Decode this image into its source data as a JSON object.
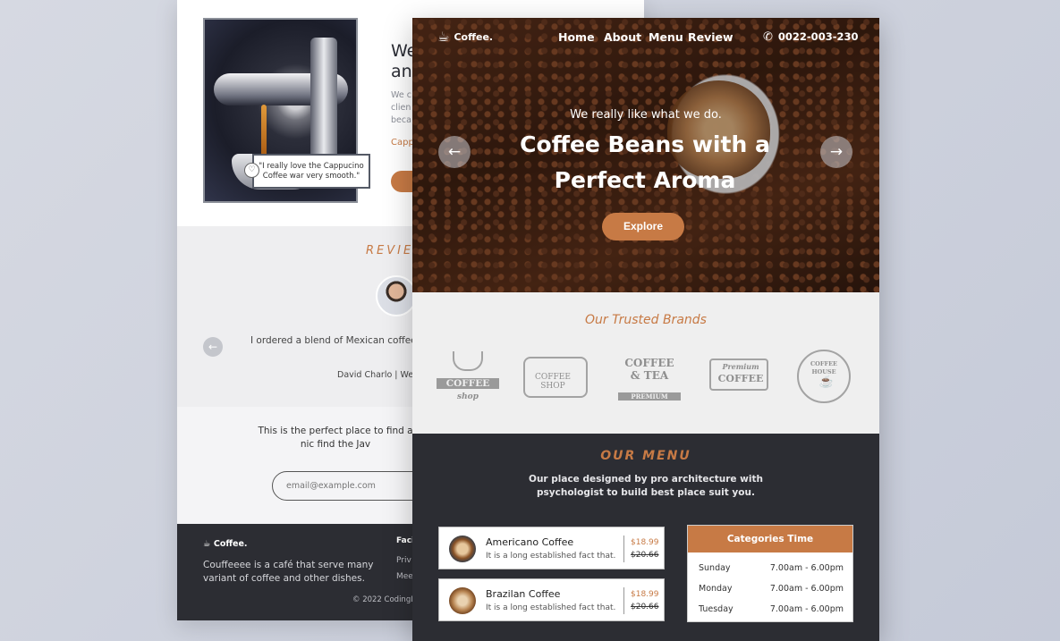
{
  "back_page": {
    "about": {
      "title": "We\nan",
      "text": "We c\nclien\nbeca",
      "link": "Capp",
      "quote": "\"I really love the Cappucino Coffee war very smooth.\""
    },
    "review": {
      "title": "REVIEW",
      "text": "I ordered a blend of Mexican coffee, delicious, very invigorat",
      "author": "David Charlo | We"
    },
    "newsletter": {
      "text": "This is the perfect place to find a nic find the Jav",
      "email_placeholder": "email@example.com"
    },
    "footer": {
      "logo": "Coffee.",
      "description": "Couffeeee is a café that serve many variant of coffee and other dishes.",
      "column_title": "Faci",
      "links": [
        "Priv",
        "Mee"
      ],
      "copyright": "© 2022 CodingLa"
    }
  },
  "front_page": {
    "nav": {
      "logo": "Coffee.",
      "links": [
        "Home",
        "About",
        "Menu",
        "Review"
      ],
      "phone": "0022-003-230"
    },
    "hero": {
      "subtitle": "We really like what we do.",
      "title": "Coffee Beans with a Perfect Aroma",
      "button": "Explore"
    },
    "brands": {
      "title": "Our Trusted Brands",
      "logos": [
        {
          "top": "COFFEE",
          "bottom": "shop"
        },
        {
          "top": "COFFEE SHOP",
          "bottom": ""
        },
        {
          "top": "COFFEE & TEA",
          "bottom": "PREMIUM"
        },
        {
          "top": "Premium",
          "bottom": "COFFEE"
        },
        {
          "top": "COFFEE HOUSE",
          "bottom": ""
        }
      ]
    },
    "menu": {
      "title": "OUR MENU",
      "description": "Our place designed by pro architecture with psychologist to build best place suit you.",
      "items": [
        {
          "name": "Americano Coffee",
          "desc": "It is a long established fact that.",
          "price": "$18.99",
          "old_price": "$20.66"
        },
        {
          "name": "Brazilan Coffee",
          "desc": "It is a long established fact that.",
          "price": "$18.99",
          "old_price": "$20.66"
        }
      ],
      "categories": {
        "title": "Categories Time",
        "rows": [
          {
            "day": "Sunday",
            "time": "7.00am - 6.00pm"
          },
          {
            "day": "Monday",
            "time": "7.00am - 6.00pm"
          },
          {
            "day": "Tuesday",
            "time": "7.00am - 6.00pm"
          }
        ]
      }
    }
  },
  "colors": {
    "accent": "#c77a45",
    "dark": "#2c2d33",
    "light": "#efefef"
  },
  "icons": [
    "coffee-mug-icon",
    "phone-icon",
    "arrow-left-icon",
    "arrow-right-icon",
    "heart-icon"
  ]
}
